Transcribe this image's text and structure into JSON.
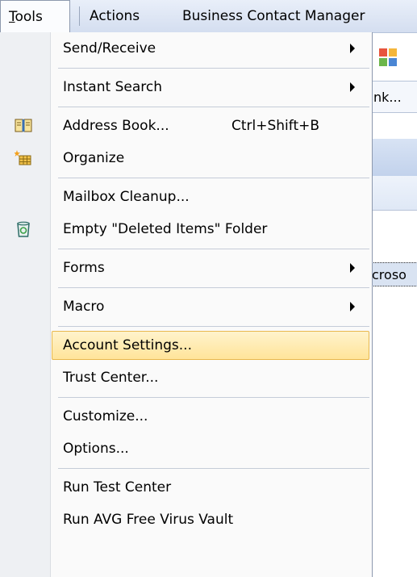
{
  "menubar": {
    "tools": "Tools",
    "actions": "Actions",
    "bcm": "Business Contact Manager"
  },
  "background": {
    "button_fragment": "nk...",
    "list_fragment": "croso"
  },
  "menu": {
    "send_receive": "Send/Receive",
    "instant_search": "Instant Search",
    "address_book": "Address Book...",
    "address_book_shortcut": "Ctrl+Shift+B",
    "organize": "Organize",
    "mailbox_cleanup": "Mailbox Cleanup...",
    "empty_deleted": "Empty \"Deleted Items\" Folder",
    "forms": "Forms",
    "macro": "Macro",
    "account_settings": "Account Settings...",
    "trust_center": "Trust Center...",
    "customize": "Customize...",
    "options": "Options...",
    "run_test_center": "Run Test Center",
    "run_avg": "Run AVG Free Virus Vault"
  },
  "colors": {
    "highlight": "#ffe49a",
    "highlight_border": "#e8b84e",
    "gutter": "#eef0f3"
  }
}
